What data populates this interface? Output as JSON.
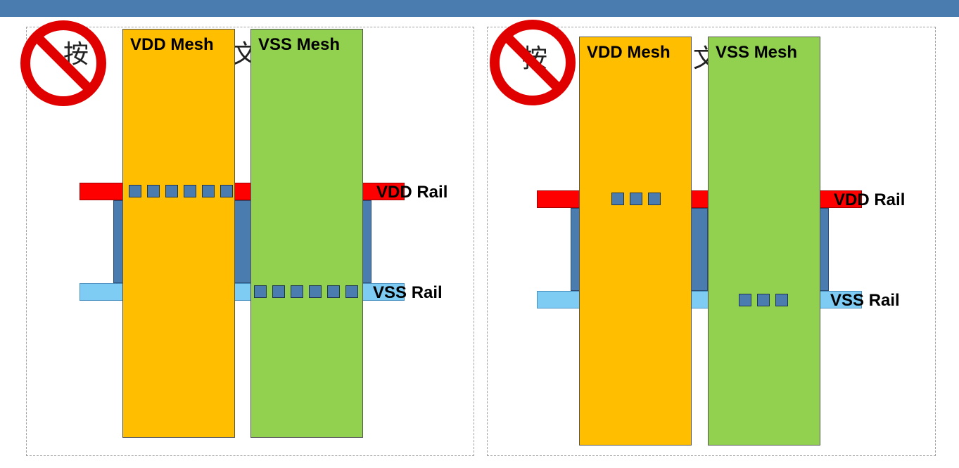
{
  "background_text": {
    "char1": "按",
    "char2": "文"
  },
  "labels": {
    "vdd_mesh": "VDD Mesh",
    "vss_mesh": "VSS Mesh",
    "vdd_rail": "VDD Rail",
    "vss_rail": "VSS Rail"
  },
  "icons": {
    "prohibited": "no-symbol-icon"
  },
  "colors": {
    "header": "#4a7cb0",
    "vdd_rail": "#ff0000",
    "vss_rail": "#7ecbf4",
    "vdd_mesh": "#ffbf00",
    "vss_mesh": "#92d050",
    "via": "#4a7cb0",
    "prohibit_red": "#e00000"
  },
  "panels": [
    {
      "id": "left",
      "vias_per_rail": 6
    },
    {
      "id": "right",
      "vias_per_rail": 3
    }
  ]
}
